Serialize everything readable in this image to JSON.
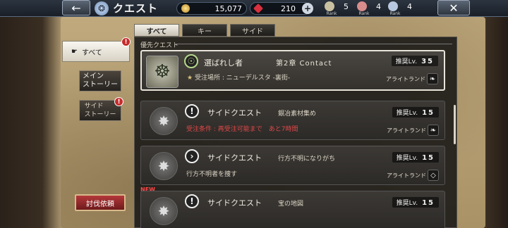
{
  "header": {
    "back_icon": "arrow-left-icon",
    "title": "クエスト",
    "gold": "15,077",
    "gems": "210",
    "ranks": [
      {
        "value": "5",
        "label": "Rank",
        "color": "#c8c0a0"
      },
      {
        "value": "4",
        "label": "Rank",
        "color": "#d88c8c"
      },
      {
        "value": "4",
        "label": "Rank",
        "color": "#b8c8e0"
      }
    ],
    "close_icon": "close-icon"
  },
  "tabs": [
    "すべて",
    "キー",
    "サイド"
  ],
  "sidebar": {
    "all": "すべて",
    "main_line1": "メイン",
    "main_line2": "ストーリー",
    "side_line1": "サイド",
    "side_line2": "ストーリー",
    "hunt": "討伐依頼"
  },
  "section": {
    "priority": "優先クエスト"
  },
  "quests": {
    "featured": {
      "name": "選ばれし者",
      "chapter": "第2章 Contact",
      "location_label": "受注場所 : ニューデルスタ -裏街-",
      "lv_label": "推奨Lv.",
      "lv": "35",
      "region": "アライトランド"
    },
    "q1": {
      "name": "サイドクエスト",
      "title": "銀冶素材集め",
      "condition": "受注条件 : 再受注可能まで　あと7時間",
      "lv_label": "推奨Lv.",
      "lv": "15",
      "region": "アライトランド"
    },
    "q2": {
      "name": "サイドクエスト",
      "title": "行方不明になりがち",
      "desc": "行方不明者を捜す",
      "lv_label": "推奨Lv.",
      "lv": "15",
      "region": "アライトランド"
    },
    "q3": {
      "new": "NEW",
      "name": "サイドクエスト",
      "title": "宝の地図",
      "lv_label": "推奨Lv.",
      "lv": "15"
    }
  }
}
